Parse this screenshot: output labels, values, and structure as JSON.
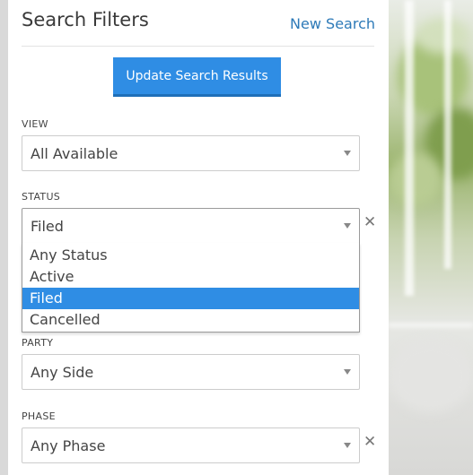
{
  "panel": {
    "title": "Search Filters",
    "new_search_label": "New Search",
    "update_button_label": "Update Search Results"
  },
  "filters": {
    "view": {
      "label": "VIEW",
      "value": "All Available"
    },
    "status": {
      "label": "STATUS",
      "value": "Filed",
      "clear_icon": "close-icon",
      "options": [
        "Any Status",
        "Active",
        "Filed",
        "Cancelled"
      ],
      "highlighted": "Filed"
    },
    "party": {
      "label": "PARTY",
      "value": "Any Side"
    },
    "phase": {
      "label": "PHASE",
      "value": "Any Phase",
      "clear_icon": "close-icon"
    }
  },
  "colors": {
    "accent": "#2f8de4",
    "link": "#2d7ab8",
    "text": "#444444"
  }
}
